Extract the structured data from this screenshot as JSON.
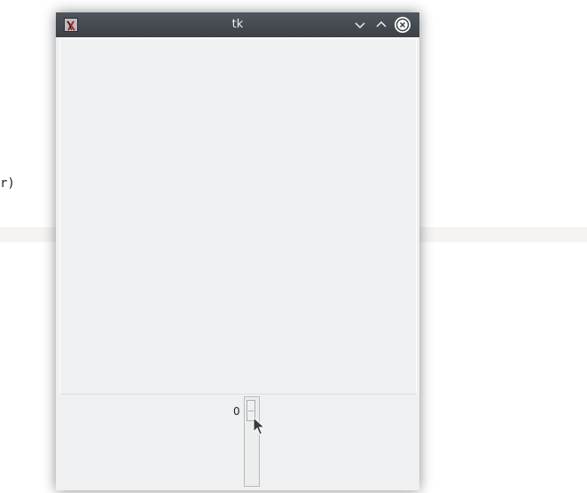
{
  "background": {
    "code_fragment": "r)"
  },
  "window": {
    "title": "tk",
    "buttons": {
      "minimize": "chevron-down-icon",
      "maximize": "chevron-up-icon",
      "close": "close-icon"
    }
  },
  "scale": {
    "value": "0",
    "level_fraction": 0.0
  },
  "colors": {
    "titlebar": "#475057",
    "window_bg": "#eff0f1",
    "close_bg": "#ffffff"
  }
}
